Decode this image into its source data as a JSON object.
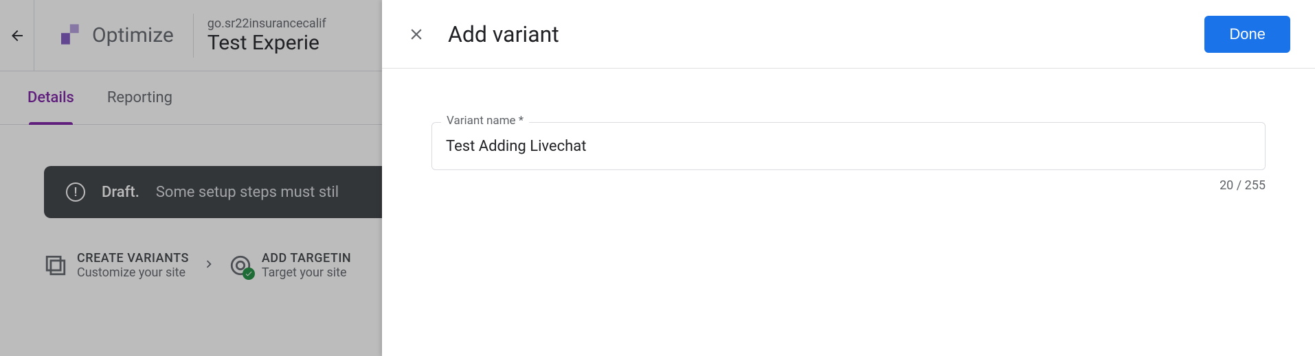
{
  "header": {
    "product_name": "Optimize",
    "subtitle": "go.sr22insurancecalif",
    "experience_title": "Test Experie"
  },
  "tabs": {
    "details": "Details",
    "reporting": "Reporting"
  },
  "draft_bar": {
    "label": "Draft.",
    "message": "Some setup steps must stil"
  },
  "steps": {
    "create_variants": {
      "title": "CREATE VARIANTS",
      "sub": "Customize your site"
    },
    "add_targeting": {
      "title": "ADD TARGETIN",
      "sub": "Target your site"
    }
  },
  "modal": {
    "title": "Add variant",
    "done_label": "Done",
    "field_label": "Variant name *",
    "field_value": "Test Adding Livechat",
    "counter": "20 / 255"
  }
}
